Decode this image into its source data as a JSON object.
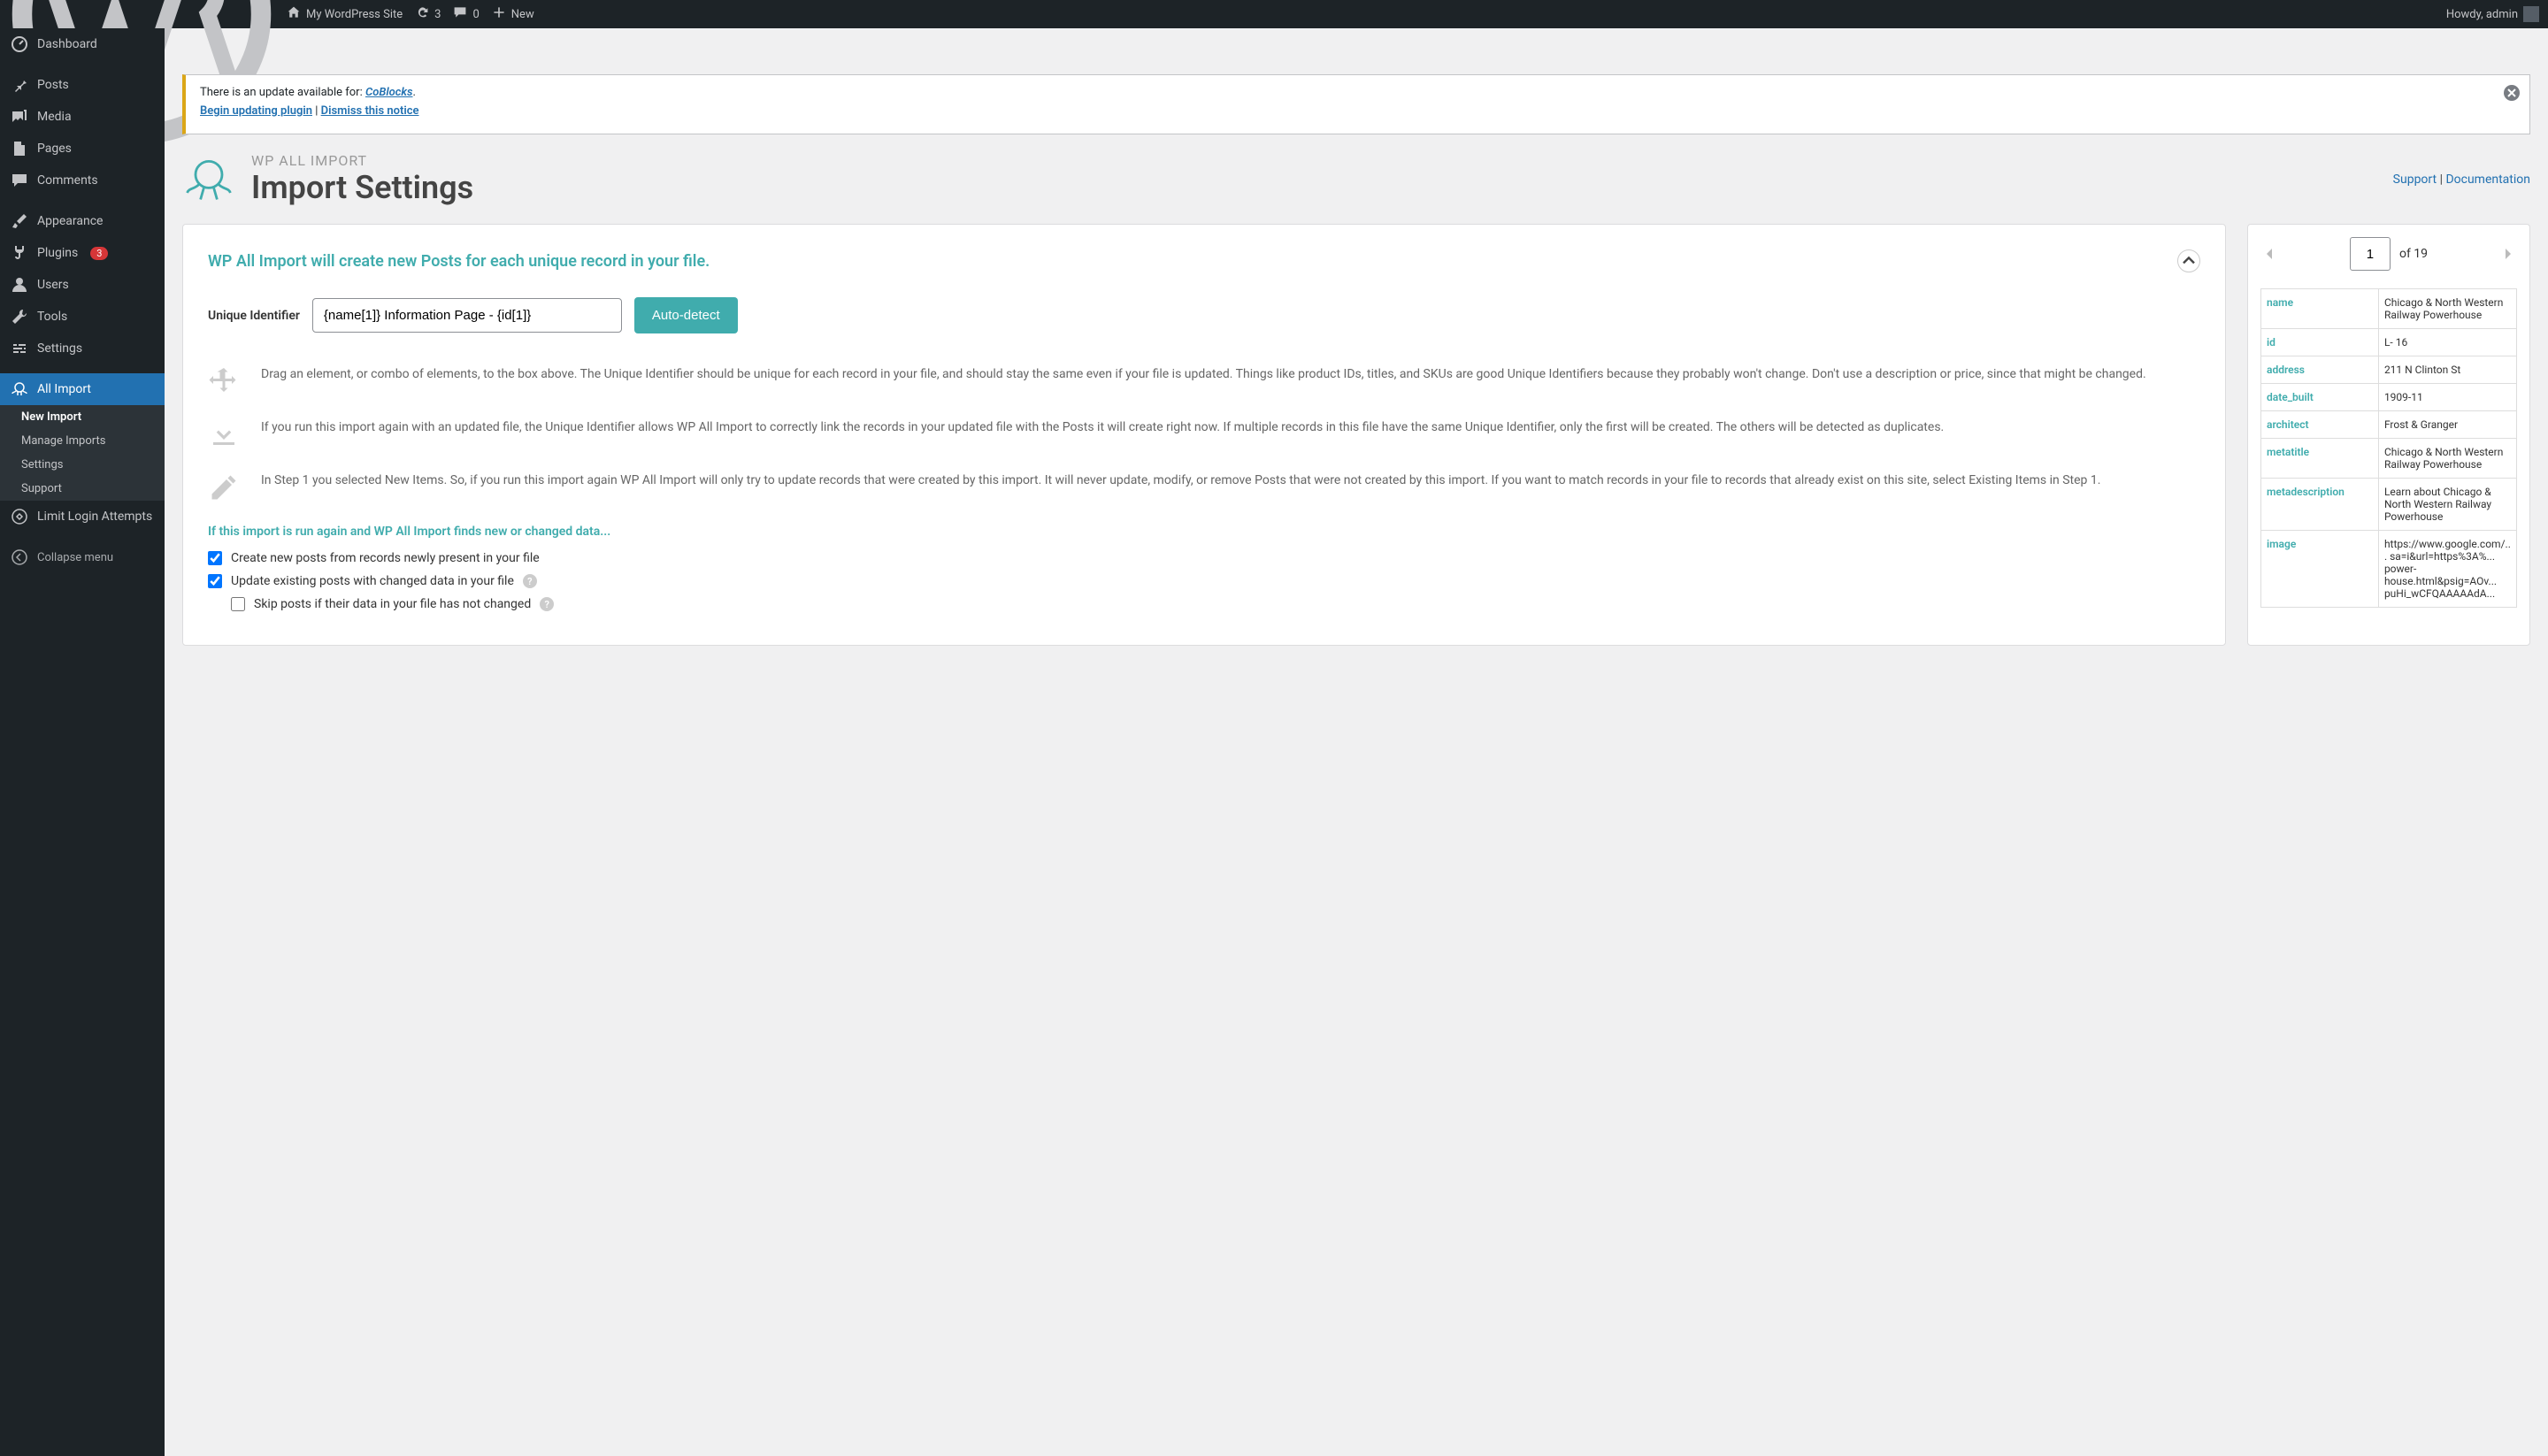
{
  "topbar": {
    "site_name": "My WordPress Site",
    "updates": "3",
    "comments": "0",
    "new": "New",
    "howdy": "Howdy, admin"
  },
  "sidebar": {
    "items": [
      {
        "label": "Dashboard",
        "name": "dashboard"
      },
      {
        "label": "Posts",
        "name": "posts"
      },
      {
        "label": "Media",
        "name": "media"
      },
      {
        "label": "Pages",
        "name": "pages"
      },
      {
        "label": "Comments",
        "name": "comments"
      },
      {
        "label": "Appearance",
        "name": "appearance"
      },
      {
        "label": "Plugins",
        "name": "plugins",
        "badge": "3"
      },
      {
        "label": "Users",
        "name": "users"
      },
      {
        "label": "Tools",
        "name": "tools"
      },
      {
        "label": "Settings",
        "name": "settings"
      },
      {
        "label": "All Import",
        "name": "all-import",
        "active": true
      },
      {
        "label": "Limit Login Attempts",
        "name": "limit-login"
      }
    ],
    "sub": [
      {
        "label": "New Import",
        "current": true
      },
      {
        "label": "Manage Imports"
      },
      {
        "label": "Settings"
      },
      {
        "label": "Support"
      }
    ],
    "collapse": "Collapse menu"
  },
  "notice": {
    "text1": "There is an update available for: ",
    "plugin_link": "CoBlocks",
    "begin_link": "Begin updating plugin",
    "dismiss_link": "Dismiss this notice"
  },
  "header": {
    "breadcrumb": "WP ALL IMPORT",
    "title": "Import Settings",
    "support": "Support",
    "docs": "Documentation"
  },
  "panel": {
    "title": "WP All Import will create new Posts for each unique record in your file.",
    "identifier_label": "Unique Identifier",
    "identifier_value": "{name[1]} Information Page - {id[1]}",
    "auto_detect": "Auto-detect",
    "info1": "Drag an element, or combo of elements, to the box above. The Unique Identifier should be unique for each record in your file, and should stay the same even if your file is updated. Things like product IDs, titles, and SKUs are good Unique Identifiers because they probably won't change. Don't use a description or price, since that might be changed.",
    "info2": "If you run this import again with an updated file, the Unique Identifier allows WP All Import to correctly link the records in your updated file with the Posts it will create right now. If multiple records in this file have the same Unique Identifier, only the first will be created. The others will be detected as duplicates.",
    "info3": "In Step 1 you selected New Items. So, if you run this import again WP All Import will only try to update records that were created by this import. It will never update, modify, or remove Posts that were not created by this import. If you want to match records in your file to records that already exist on this site, select Existing Items in Step 1.",
    "section2": "If this import is run again and WP All Import finds new or changed data...",
    "cb1": "Create new posts from records newly present in your file",
    "cb2": "Update existing posts with changed data in your file",
    "cb3": "Skip posts if their data in your file has not changed"
  },
  "preview": {
    "page": "1",
    "of": "of 19",
    "rows": [
      {
        "k": "name",
        "v": "Chicago & North Western Railway Powerhouse"
      },
      {
        "k": "id",
        "v": "L- 16"
      },
      {
        "k": "address",
        "v": "211 N Clinton St"
      },
      {
        "k": "date_built",
        "v": "1909-11"
      },
      {
        "k": "architect",
        "v": "Frost & Granger"
      },
      {
        "k": "metatitle",
        "v": "Chicago & North Western Railway Powerhouse"
      },
      {
        "k": "metadescription",
        "v": "Learn about Chicago & North Western Railway Powerhouse"
      },
      {
        "k": "image",
        "v": "https://www.google.com/... sa=i&url=https%3A%... power-house.html&psig=AOv... puHi_wCFQAAAAAdA..."
      }
    ]
  }
}
